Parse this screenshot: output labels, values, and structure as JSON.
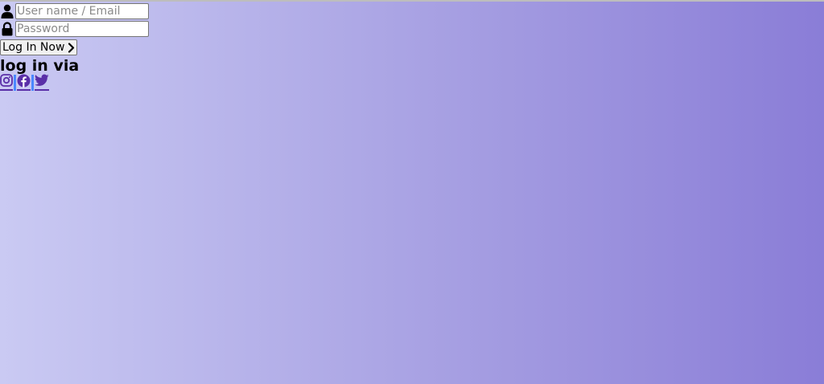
{
  "form": {
    "username_placeholder": "User name / Email",
    "password_placeholder": "Password",
    "login_label": "Log In Now",
    "via_heading": "log in via"
  },
  "icons": {
    "user": "user-icon",
    "lock": "lock-icon",
    "chevron": "chevron-right-icon",
    "instagram": "instagram-icon",
    "facebook": "facebook-icon",
    "twitter": "twitter-icon"
  },
  "colors": {
    "gradient_start": "#cacaf3",
    "gradient_end": "#8a7dd7",
    "social_icon": "#5a2fa8",
    "separator": "#4a88ff"
  }
}
